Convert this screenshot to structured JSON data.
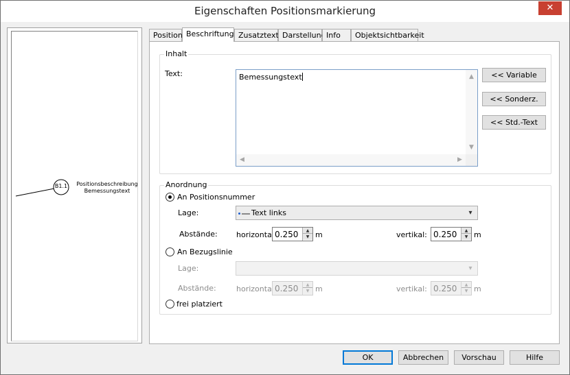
{
  "window": {
    "title": "Eigenschaften Positionsmarkierung",
    "close_glyph": "✕"
  },
  "preview": {
    "marker_label": "B1.1",
    "description_line1": "Positionsbeschreibung",
    "description_line2": "Bemessungstext"
  },
  "tabs": [
    {
      "label": "Position"
    },
    {
      "label": "Beschriftung"
    },
    {
      "label": "Zusatztext"
    },
    {
      "label": "Darstellung"
    },
    {
      "label": "Info"
    },
    {
      "label": "Objektsichtbarkeit"
    }
  ],
  "inhalt": {
    "group_label": "Inhalt",
    "text_label": "Text:",
    "text_value": "Bemessungstext",
    "buttons": {
      "variable": "<< Variable",
      "sonderz": "<< Sonderz.",
      "std_text": "<< Std.-Text"
    }
  },
  "anordnung": {
    "group_label": "Anordnung",
    "option1": {
      "label": "An Positionsnummer",
      "lage_label": "Lage:",
      "lage_value": "Text links",
      "abstaende_label": "Abstände:",
      "horizontal_label": "horizontal:",
      "horizontal_value": "0.250",
      "horizontal_unit": "m",
      "vertikal_label": "vertikal:",
      "vertikal_value": "0.250",
      "vertikal_unit": "m"
    },
    "option2": {
      "label": "An Bezugslinie",
      "lage_label": "Lage:",
      "abstaende_label": "Abstände:",
      "horizontal_label": "horizontal:",
      "horizontal_value": "0.250",
      "horizontal_unit": "m",
      "vertikal_label": "vertikal:",
      "vertikal_value": "0.250",
      "vertikal_unit": "m"
    },
    "option3": {
      "label": "frei platziert"
    }
  },
  "footer": {
    "ok": "OK",
    "cancel": "Abbrechen",
    "preview": "Vorschau",
    "help": "Hilfe"
  }
}
